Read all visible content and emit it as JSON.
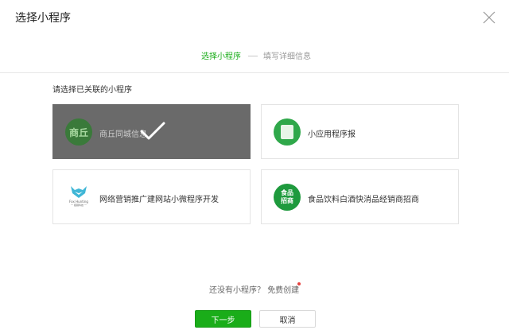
{
  "dialog": {
    "title": "选择小程序"
  },
  "steps": {
    "step1": "选择小程序",
    "step2": "填写详细信息"
  },
  "prompt": "请选择已关联的小程序",
  "apps": [
    {
      "name": "商丘同城信息",
      "logo_text": "商丘",
      "selected": true
    },
    {
      "name": "小应用程序报",
      "selected": false
    },
    {
      "name": "网络营销推广建网站小微程序开发",
      "logo_text": "Fox Hunting",
      "logo_subtext": "一 狐猎科技 一",
      "selected": false
    },
    {
      "name": "食品饮料白酒快消品经销商招商",
      "logo_text_line1": "食品",
      "logo_text_line2": "招商",
      "selected": false
    }
  ],
  "footer": {
    "question": "还没有小程序？",
    "create_link": "免费创建"
  },
  "buttons": {
    "next": "下一步",
    "cancel": "取消"
  },
  "colors": {
    "accent": "#1aad19",
    "selected_overlay": "#6a6a6a",
    "badge": "#e64340"
  }
}
